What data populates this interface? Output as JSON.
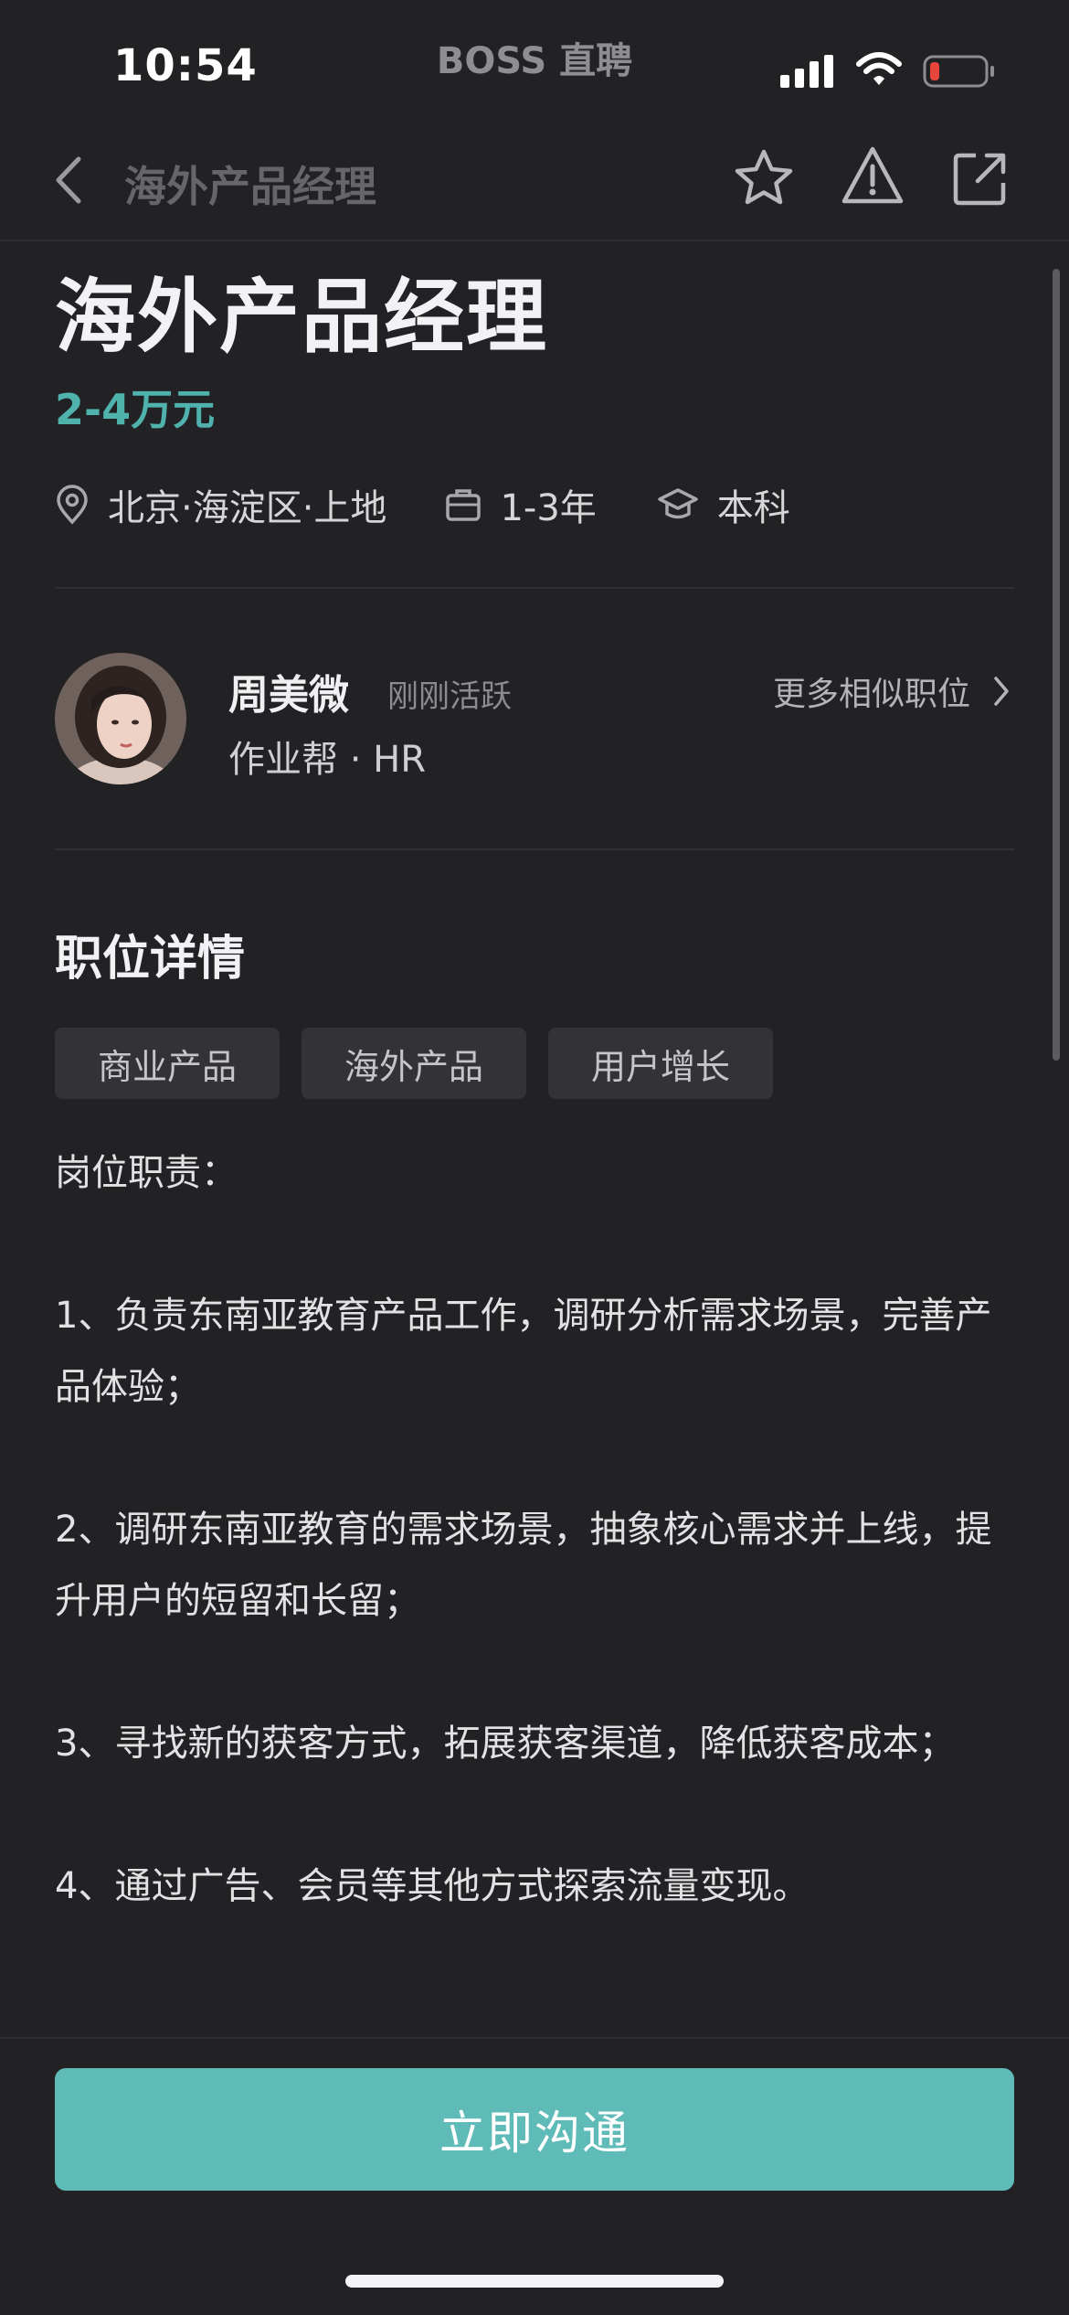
{
  "status_bar": {
    "time": "10:54",
    "app_brand": "BOSS 直聘",
    "battery_color": "#e5453b"
  },
  "nav": {
    "title": "海外产品经理",
    "icons": [
      "back-icon",
      "star-icon",
      "warning-icon",
      "share-icon"
    ]
  },
  "job": {
    "title": "海外产品经理",
    "salary": "2-4万元",
    "salary_color": "#4fb2ad",
    "location": "北京·海淀区·上地",
    "experience": "1-3年",
    "education": "本科"
  },
  "recruiter": {
    "name": "周美微",
    "status": "刚刚活跃",
    "company_role": "作业帮 · HR",
    "more_link": "更多相似职位"
  },
  "details": {
    "section_title": "职位详情",
    "tags": [
      "商业产品",
      "海外产品",
      "用户增长"
    ],
    "description_heading": "岗位职责：",
    "responsibilities": [
      "1、负责东南亚教育产品工作，调研分析需求场景，完善产品体验；",
      "2、调研东南亚教育的需求场景，抽象核心需求并上线，提升用户的短留和长留；",
      "3、寻找新的获客方式，拓展获客渠道，降低获客成本；",
      "4、通过广告、会员等其他方式探索流量变现。"
    ]
  },
  "bottom": {
    "chat_button": "立即沟通",
    "button_color": "#5fbbb7"
  }
}
